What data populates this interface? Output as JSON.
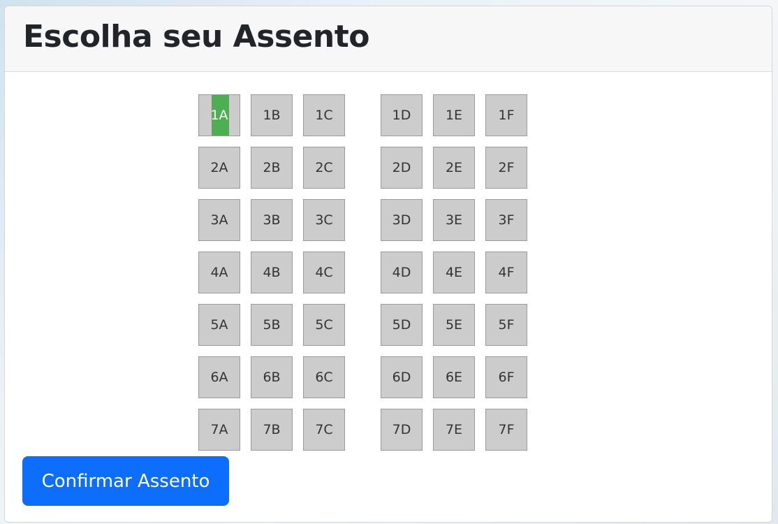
{
  "header": {
    "title": "Escolha seu Assento"
  },
  "seat_map": {
    "selected_seat": "1A",
    "rows": [
      {
        "left": [
          "1A",
          "1B",
          "1C"
        ],
        "right": [
          "1D",
          "1E",
          "1F"
        ]
      },
      {
        "left": [
          "2A",
          "2B",
          "2C"
        ],
        "right": [
          "2D",
          "2E",
          "2F"
        ]
      },
      {
        "left": [
          "3A",
          "3B",
          "3C"
        ],
        "right": [
          "3D",
          "3E",
          "3F"
        ]
      },
      {
        "left": [
          "4A",
          "4B",
          "4C"
        ],
        "right": [
          "4D",
          "4E",
          "4F"
        ]
      },
      {
        "left": [
          "5A",
          "5B",
          "5C"
        ],
        "right": [
          "5D",
          "5E",
          "5F"
        ]
      },
      {
        "left": [
          "6A",
          "6B",
          "6C"
        ],
        "right": [
          "6D",
          "6E",
          "6F"
        ]
      },
      {
        "left": [
          "7A",
          "7B",
          "7C"
        ],
        "right": [
          "7D",
          "7E",
          "7F"
        ]
      }
    ]
  },
  "actions": {
    "confirm_label": "Confirmar Assento"
  },
  "colors": {
    "seat_available": "#cccccc",
    "seat_selected": "#4caf50",
    "primary_button": "#0d6efd"
  }
}
